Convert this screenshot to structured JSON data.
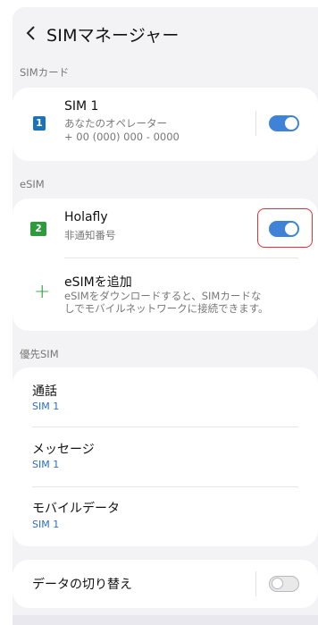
{
  "header": {
    "title": "SIMマネージャー"
  },
  "sim_section": {
    "label": "SIMカード",
    "sim1": {
      "badge": "1",
      "name": "SIM 1",
      "operator": "あなたのオペレーター",
      "number": "+ 00 (000) 000 - 0000",
      "enabled": true
    }
  },
  "esim_section": {
    "label": "eSIM",
    "holafly": {
      "badge": "2",
      "name": "Holafly",
      "number": "非通知番号",
      "enabled": true
    },
    "add": {
      "title": "eSIMを追加",
      "desc1": "eSIMをダウンロードすると、SIMカードな",
      "desc2": "しでモバイルネットワークに接続できます。"
    }
  },
  "priority_section": {
    "label": "優先SIM",
    "items": [
      {
        "title": "通話",
        "value": "SIM 1"
      },
      {
        "title": "メッセージ",
        "value": "SIM 1"
      },
      {
        "title": "モバイルデータ",
        "value": "SIM 1"
      }
    ]
  },
  "data_switch": {
    "label": "データの切り替え",
    "enabled": false
  },
  "colors": {
    "accent": "#3f83d8",
    "link": "#2a6fbf",
    "sim1": "#1a73b8",
    "esim": "#2e9b3d",
    "highlight": "#e0303a"
  }
}
